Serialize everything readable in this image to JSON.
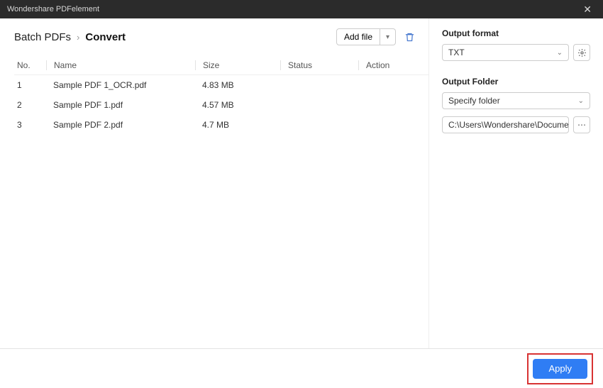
{
  "titlebar": {
    "title": "Wondershare PDFelement"
  },
  "breadcrumb": {
    "parent": "Batch PDFs",
    "current": "Convert"
  },
  "toolbar": {
    "add_file": "Add file"
  },
  "table": {
    "headers": {
      "no": "No.",
      "name": "Name",
      "size": "Size",
      "status": "Status",
      "action": "Action"
    },
    "rows": [
      {
        "no": "1",
        "name": "Sample PDF 1_OCR.pdf",
        "size": "4.83 MB",
        "status": "",
        "action": ""
      },
      {
        "no": "2",
        "name": "Sample PDF 1.pdf",
        "size": "4.57 MB",
        "status": "",
        "action": ""
      },
      {
        "no": "3",
        "name": "Sample PDF 2.pdf",
        "size": "4.7 MB",
        "status": "",
        "action": ""
      }
    ]
  },
  "side": {
    "output_format_label": "Output format",
    "output_format_value": "TXT",
    "output_folder_label": "Output Folder",
    "output_folder_mode": "Specify folder",
    "output_folder_path": "C:\\Users\\Wondershare\\Documents"
  },
  "footer": {
    "apply": "Apply"
  }
}
